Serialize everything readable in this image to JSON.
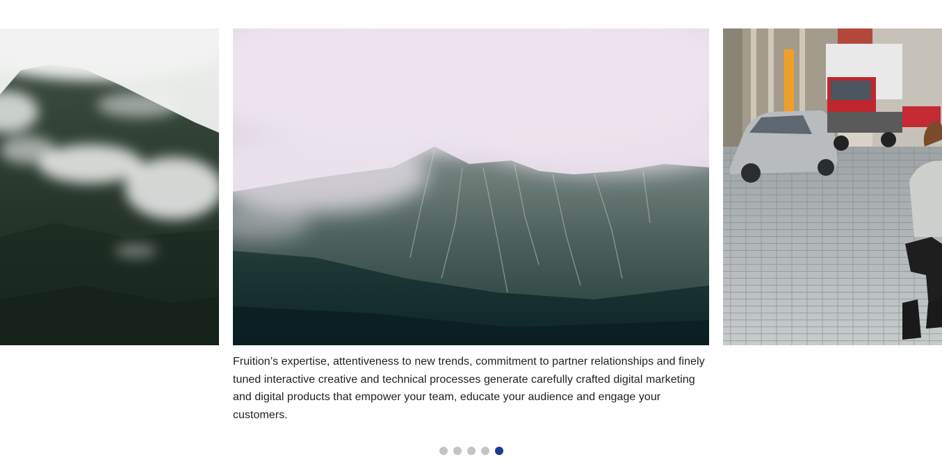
{
  "carousel": {
    "slides": [
      {
        "image_icon": "misty-forest-mountain-image"
      },
      {
        "image_icon": "foggy-mountain-ridge-image"
      },
      {
        "image_icon": "city-street-child-image"
      }
    ],
    "caption": "Fruition’s expertise, attentiveness to new trends, commitment to partner relationships and finely tuned interactive creative and technical processes generate carefully crafted digital marketing and digital products that empower your team, educate your audience and engage your customers.",
    "pagination": {
      "count": 5,
      "active_index": 4
    }
  },
  "colors": {
    "dot_inactive": "#c4c4c4",
    "dot_active": "#1a3d8f",
    "caption_text": "#1e1e1e"
  }
}
